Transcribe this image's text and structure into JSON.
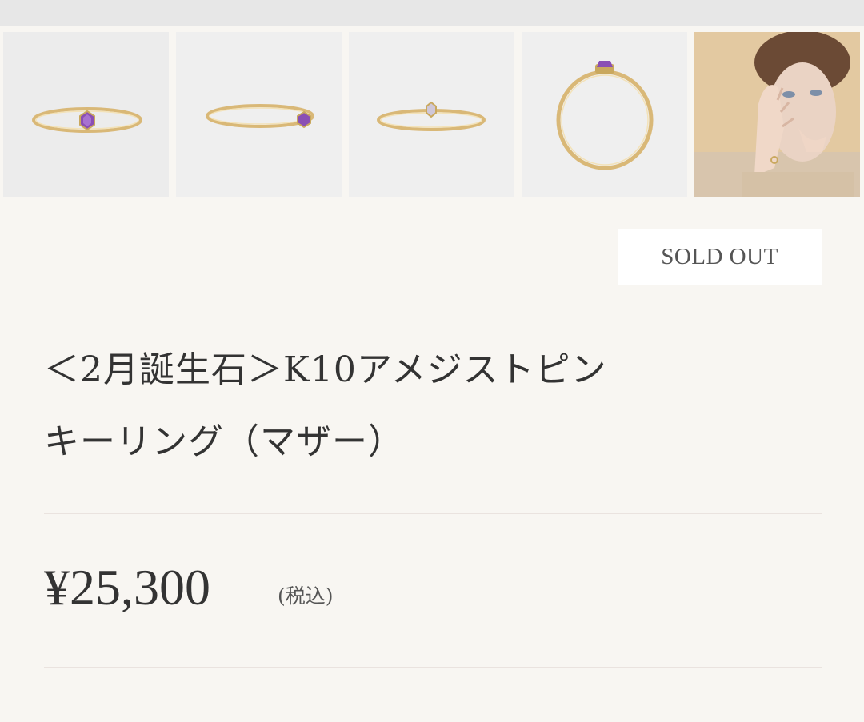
{
  "gallery": {
    "thumbnails": [
      {
        "label": "ring-front-view",
        "kind": "product"
      },
      {
        "label": "ring-angled-view",
        "kind": "product"
      },
      {
        "label": "ring-back-view",
        "kind": "product"
      },
      {
        "label": "ring-side-view",
        "kind": "product"
      },
      {
        "label": "model-wearing-ring",
        "kind": "model"
      }
    ]
  },
  "product": {
    "status": "SOLD OUT",
    "title_line1": "＜2月誕生石＞K10アメジストピン",
    "title_line2": "キーリング（マザー）",
    "price": "¥25,300",
    "tax_note": "(税込)"
  },
  "colors": {
    "background": "#f8f6f2",
    "thumb_bg": "#ececec",
    "gold": "#d9b877",
    "amethyst": "#8a4fb4",
    "divider": "#eae3df",
    "text": "#333333"
  }
}
